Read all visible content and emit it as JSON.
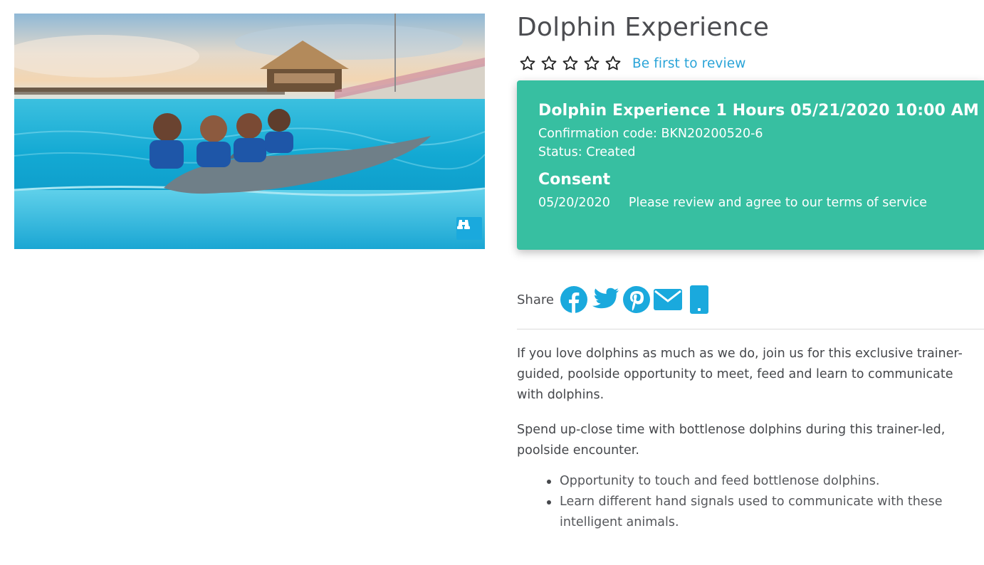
{
  "product": {
    "title": "Dolphin Experience",
    "image_alt": "Guests swimming with a dolphin in a pool",
    "gallery_icon": "binoculars-icon"
  },
  "rating": {
    "stars_filled": 0,
    "stars_total": 5,
    "review_link": "Be first to review"
  },
  "booking": {
    "title": "Dolphin Experience 1 Hours 05/21/2020 10:00 AM",
    "confirmation": "Confirmation code: BKN20200520-6",
    "status": "Status: Created",
    "consent_heading": "Consent",
    "consent_date": "05/20/2020",
    "consent_link": "Please review and agree to our terms of service"
  },
  "share": {
    "label": "Share",
    "icons": [
      "facebook-icon",
      "twitter-icon",
      "pinterest-icon",
      "email-icon",
      "mobile-icon"
    ]
  },
  "description": {
    "paragraph_1": "If you love dolphins as much as we do, join us for this exclusive trainer-guided, poolside opportunity to meet, feed and learn to communicate with dolphins.",
    "paragraph_2": "Spend up-close time with bottlenose dolphins during this trainer-led, poolside encounter.",
    "bullets": [
      "Opportunity to touch and feed bottlenose dolphins.",
      "Learn different hand signals used to communicate with these intelligent animals."
    ]
  },
  "colors": {
    "accent": "#37bfa1",
    "link": "#2aa4d8",
    "share_icon": "#1aa9dd",
    "text": "#4c4d51"
  }
}
